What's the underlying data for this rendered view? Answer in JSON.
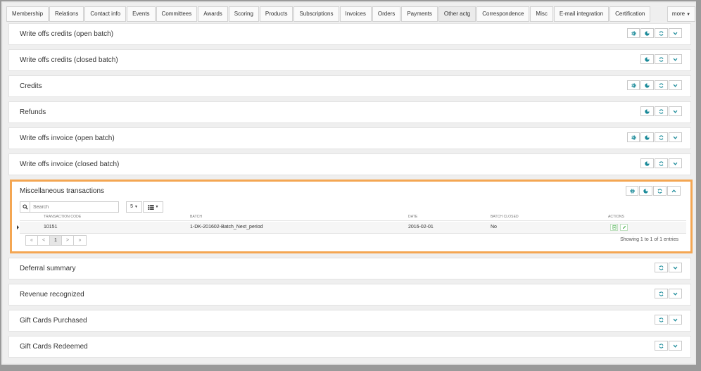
{
  "tabs": [
    {
      "label": "Membership",
      "active": false
    },
    {
      "label": "Relations",
      "active": false
    },
    {
      "label": "Contact info",
      "active": false
    },
    {
      "label": "Events",
      "active": false
    },
    {
      "label": "Committees",
      "active": false
    },
    {
      "label": "Awards",
      "active": false
    },
    {
      "label": "Scoring",
      "active": false
    },
    {
      "label": "Products",
      "active": false
    },
    {
      "label": "Subscriptions",
      "active": false
    },
    {
      "label": "Invoices",
      "active": false
    },
    {
      "label": "Orders",
      "active": false
    },
    {
      "label": "Payments",
      "active": false
    },
    {
      "label": "Other actg",
      "active": true
    },
    {
      "label": "Correspondence",
      "active": false
    },
    {
      "label": "Misc",
      "active": false
    },
    {
      "label": "E-mail integration",
      "active": false
    },
    {
      "label": "Certification",
      "active": false
    }
  ],
  "more_label": "more",
  "panels": {
    "wo_credits_open": {
      "title": "Write offs credits (open batch)"
    },
    "wo_credits_closed": {
      "title": "Write offs credits (closed batch)"
    },
    "credits": {
      "title": "Credits"
    },
    "refunds": {
      "title": "Refunds"
    },
    "wo_invoice_open": {
      "title": "Write offs invoice (open batch)"
    },
    "wo_invoice_closed": {
      "title": "Write offs invoice (closed batch)"
    },
    "misc": {
      "title": "Miscellaneous transactions"
    },
    "deferral": {
      "title": "Deferral summary"
    },
    "revenue": {
      "title": "Revenue recognized"
    },
    "gc_purchased": {
      "title": "Gift Cards Purchased"
    },
    "gc_redeemed": {
      "title": "Gift Cards Redeemed"
    }
  },
  "misc_table": {
    "search_placeholder": "Search",
    "page_length": "5",
    "columns": [
      "TRANSACTION CODE",
      "BATCH",
      "DATE",
      "BATCH CLOSED",
      "ACTIONS"
    ],
    "rows": [
      {
        "code": "10151",
        "batch": "1-DK-201602-Batch_Next_period",
        "date": "2016-02-01",
        "closed": "No"
      }
    ],
    "pager": [
      "«",
      "<",
      "1",
      ">",
      "»"
    ],
    "info": "Showing 1 to 1 of 1 entries"
  },
  "colors": {
    "accent": "#1a8a99",
    "highlight": "#f4a652"
  }
}
